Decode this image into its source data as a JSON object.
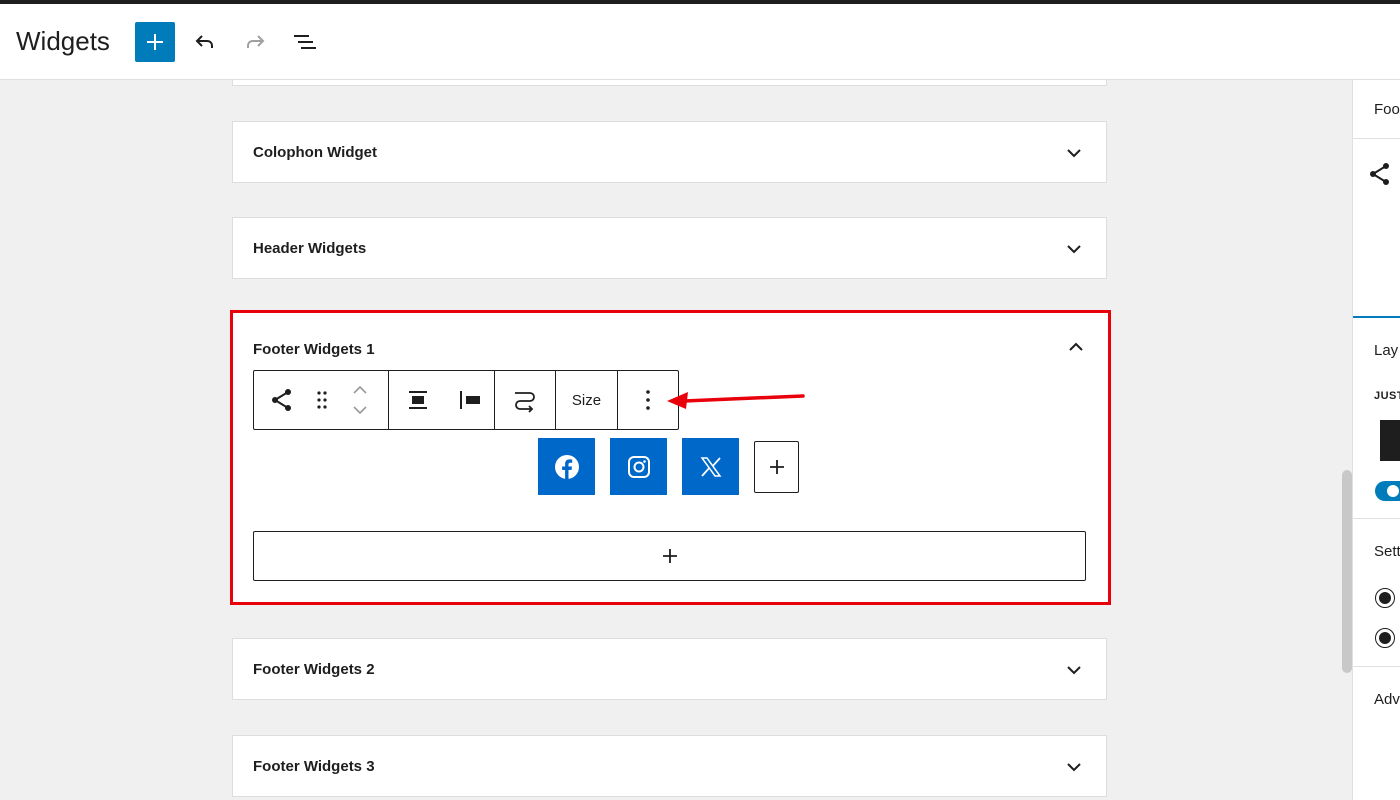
{
  "header": {
    "title": "Widgets",
    "add_icon": "plus-icon",
    "undo_icon": "undo-icon",
    "redo_icon": "redo-icon",
    "list_view_icon": "list-view-icon"
  },
  "widget_areas": {
    "colophon": {
      "title": "Colophon Widget"
    },
    "header_widgets": {
      "title": "Header Widgets"
    },
    "footer_1": {
      "title": "Footer Widgets 1"
    },
    "footer_2": {
      "title": "Footer Widgets 2"
    },
    "footer_3": {
      "title": "Footer Widgets 3"
    }
  },
  "block_toolbar": {
    "size_label": "Size",
    "icons": [
      "share-icon",
      "drag-handle-icon",
      "move-up-icon",
      "move-down-icon",
      "align-center-icon",
      "justify-left-icon",
      "wrap-icon",
      "more-options-icon"
    ]
  },
  "social_links": [
    {
      "name": "facebook",
      "icon": "facebook-icon"
    },
    {
      "name": "instagram",
      "icon": "instagram-icon"
    },
    {
      "name": "x",
      "icon": "x-icon"
    }
  ],
  "sidebar": {
    "tab_label": "Foo",
    "layout_label": "Lay",
    "justification_label": "JUST",
    "settings_label": "Sett",
    "advanced_label": "Adv"
  },
  "colors": {
    "accent": "#007cba",
    "social": "#0068c8",
    "highlight": "#e8000b"
  }
}
